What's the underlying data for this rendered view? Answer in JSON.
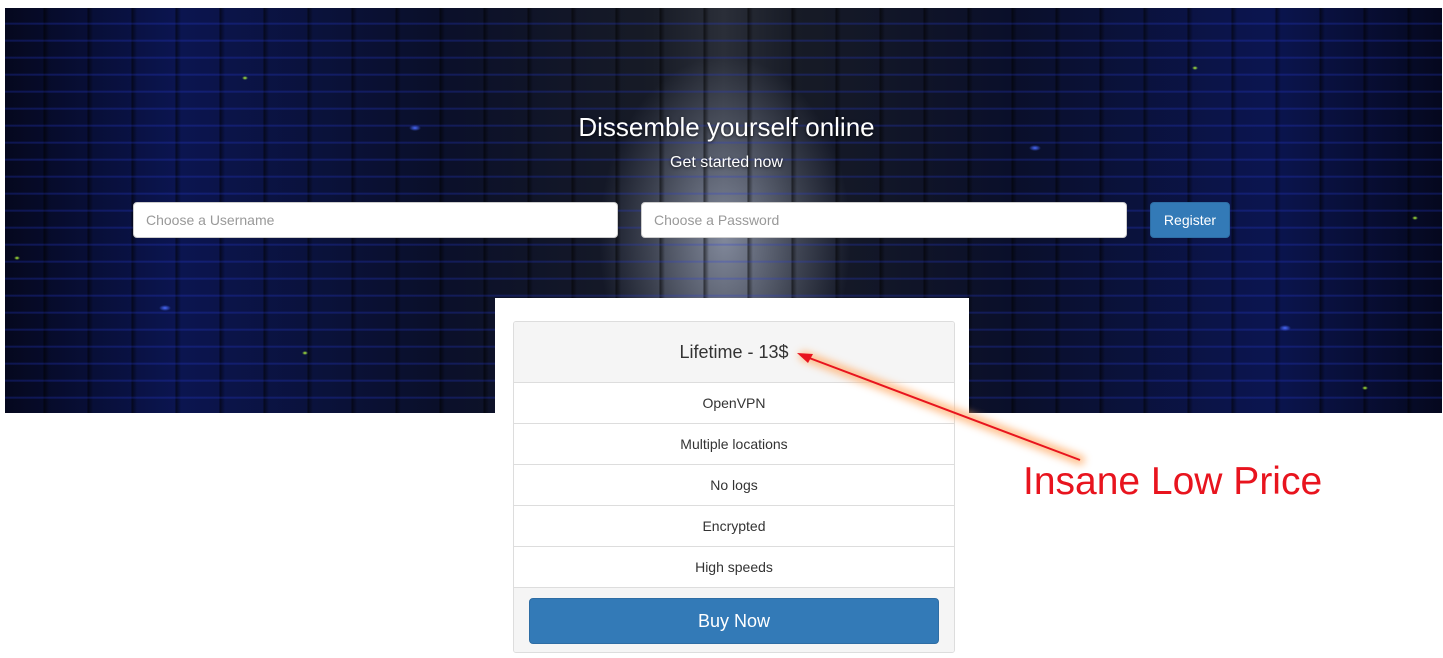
{
  "hero": {
    "title": "Dissemble yourself online",
    "subtitle": "Get started now",
    "username_placeholder": "Choose a Username",
    "password_placeholder": "Choose a Password",
    "register_label": "Register"
  },
  "pricing": {
    "plan_title": "Lifetime - 13$",
    "features": [
      "OpenVPN",
      "Multiple locations",
      "No logs",
      "Encrypted",
      "High speeds"
    ],
    "buy_label": "Buy Now"
  },
  "annotation": {
    "text": "Insane Low Price",
    "color": "#e8141e"
  },
  "colors": {
    "primary_button": "#337ab7",
    "panel_border": "#dddddd",
    "panel_heading_bg": "#f5f5f5"
  }
}
